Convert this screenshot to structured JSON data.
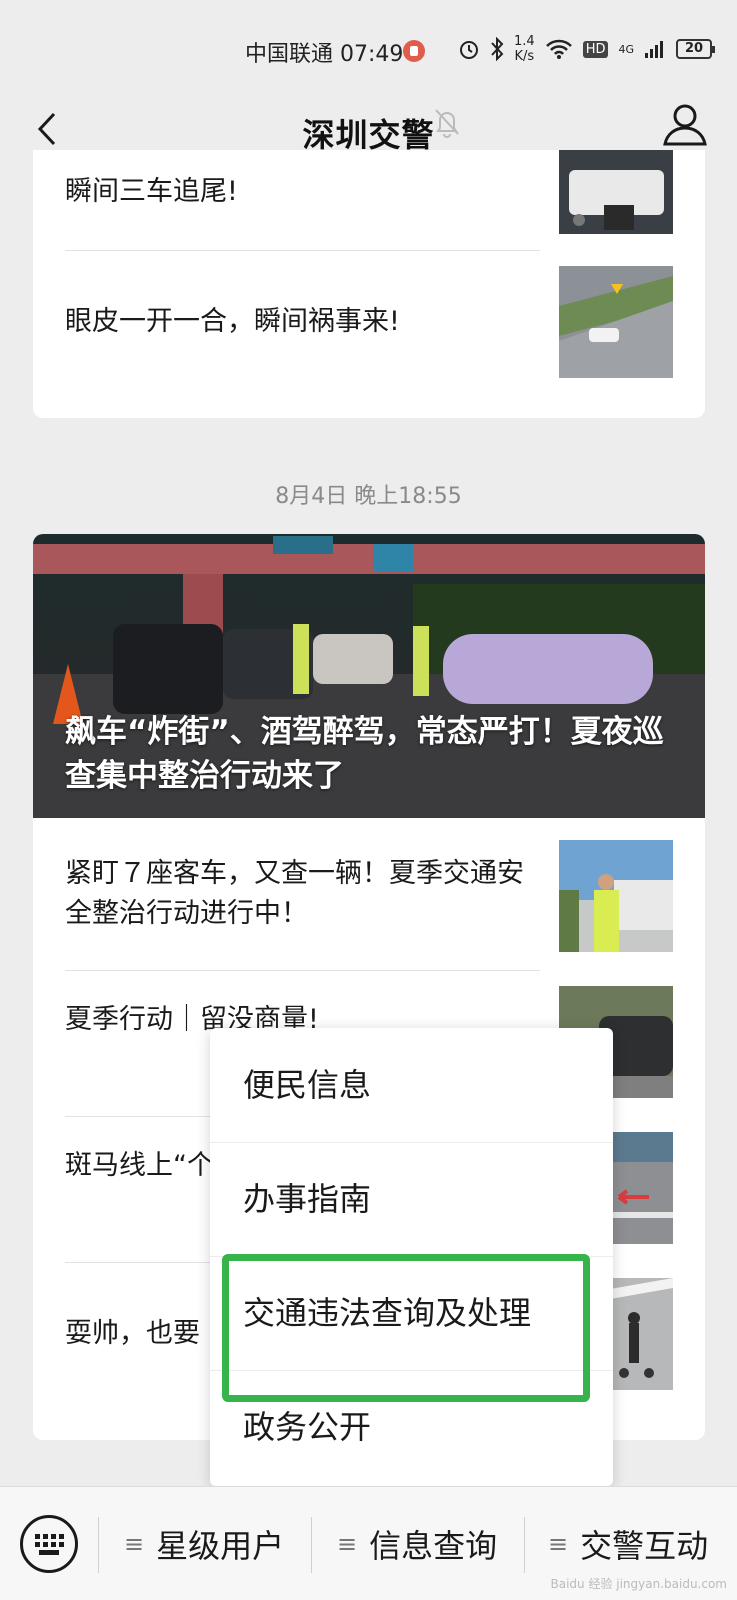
{
  "status_bar": {
    "carrier_time": "中国联通 07:49",
    "net_speed_value": "1.4",
    "net_speed_unit": "K/s",
    "hd": "HD",
    "signal": "4G",
    "battery": "20"
  },
  "header": {
    "title": "深圳交警"
  },
  "feed": {
    "group1": [
      {
        "title": "瞬间三车追尾!"
      },
      {
        "title": "眼皮一开一合，瞬间祸事来!"
      }
    ],
    "date_label": "8月4日 晚上18:55",
    "hero_title": "飙车“炸街”、酒驾醉驾，常态严打！夏夜巡查集中整治行动来了",
    "group2": [
      {
        "title": "紧盯７座客车，又查一辆！夏季交通安全整治行动进行中！"
      },
      {
        "title": "夏季行动｜留没商量!"
      },
      {
        "title": "斑马线上“个……"
      },
      {
        "title": "耍帅，也要"
      }
    ]
  },
  "popup_menu": {
    "items": [
      "便民信息",
      "办事指南",
      "交通违法查询及处理",
      "政务公开"
    ],
    "highlighted_index": 2,
    "highlight_color": "#36b34a"
  },
  "bottom_menu": {
    "items": [
      "星级用户",
      "信息查询",
      "交警互动"
    ]
  },
  "watermark": "Baidu 经验 jingyan.baidu.com"
}
